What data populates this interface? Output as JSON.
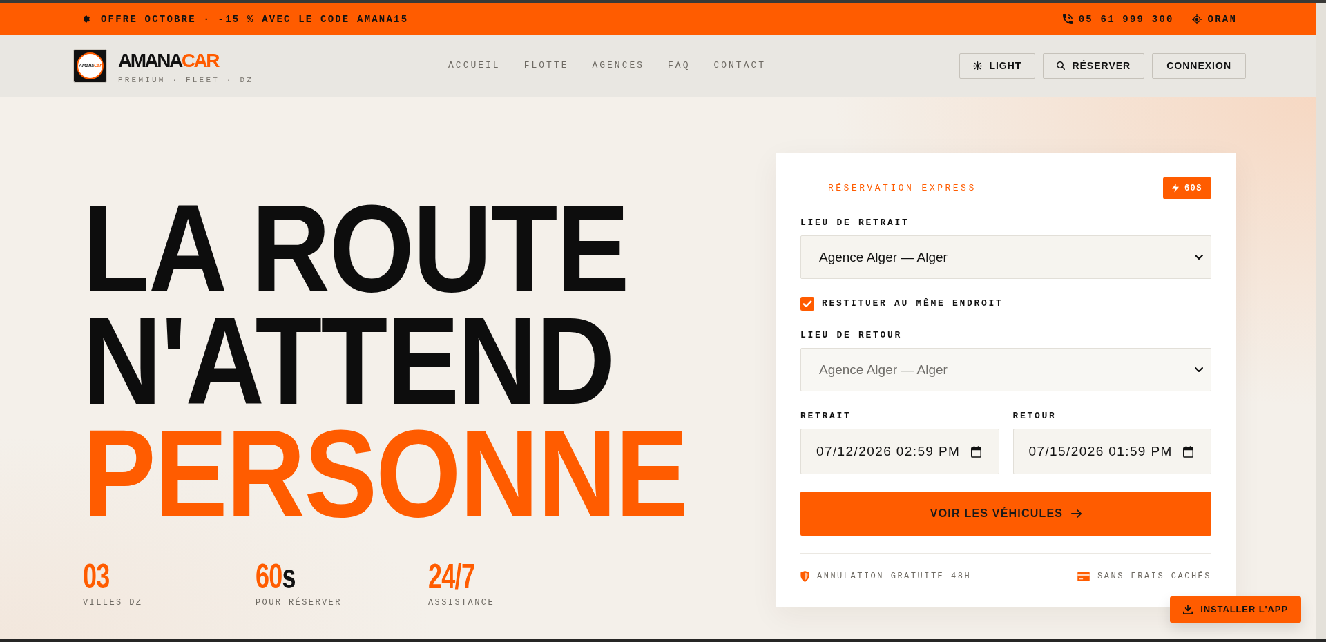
{
  "announcement_bar": {
    "offer": "OFFRE OCTOBRE · -15 % AVEC LE CODE AMANA15",
    "phone": "05 61 999 300",
    "city": "ORAN"
  },
  "header": {
    "logo_mark": {
      "start": "Amana",
      "accent": "Car"
    },
    "brand": {
      "start": "AMANA",
      "accent": "CAR"
    },
    "tagline": "PREMIUM · FLEET · DZ",
    "nav": [
      {
        "label": "ACCUEIL"
      },
      {
        "label": "FLOTTE"
      },
      {
        "label": "AGENCES"
      },
      {
        "label": "FAQ"
      },
      {
        "label": "CONTACT"
      }
    ],
    "actions": [
      {
        "kind": "theme",
        "label": "LIGHT"
      },
      {
        "kind": "search",
        "label": "RÉSERVER"
      },
      {
        "kind": "plain",
        "label": "CONNEXION"
      }
    ]
  },
  "hero": {
    "headline": [
      {
        "text": "LA ROUTE",
        "accent": false
      },
      {
        "text": "N'ATTEND",
        "accent": false
      },
      {
        "text": "PERSONNE",
        "accent": true
      }
    ],
    "stats": [
      {
        "value": "03",
        "label": "VILLES DZ"
      },
      {
        "value": "60",
        "unit": "s",
        "label": "POUR RÉSERVER"
      },
      {
        "value": "24/7",
        "label": "ASSISTANCE"
      }
    ]
  },
  "booking": {
    "title": "RÉSERVATION EXPRESS",
    "badge": "60S",
    "pickup": {
      "label": "LIEU DE RETRAIT",
      "value": "Agence Alger — Alger",
      "disabled": false
    },
    "same_place": {
      "label": "RESTITUER AU MÊME ENDROIT",
      "checked": true
    },
    "dropoff": {
      "label": "LIEU DE RETOUR",
      "value": "Agence Alger — Alger",
      "disabled": true
    },
    "dates": [
      {
        "label": "RETRAIT",
        "value": "07/12/2026 02:59 PM"
      },
      {
        "label": "RETOUR",
        "value": "07/15/2026 01:59 PM"
      }
    ],
    "submit": "VOIR LES VÉHICULES",
    "notes": [
      {
        "kind": "shield",
        "text": "ANNULATION GRATUITE 48H"
      },
      {
        "kind": "card",
        "text": "SANS FRAIS CACHÉS"
      }
    ]
  },
  "install_button": "INSTALLER L'APP"
}
